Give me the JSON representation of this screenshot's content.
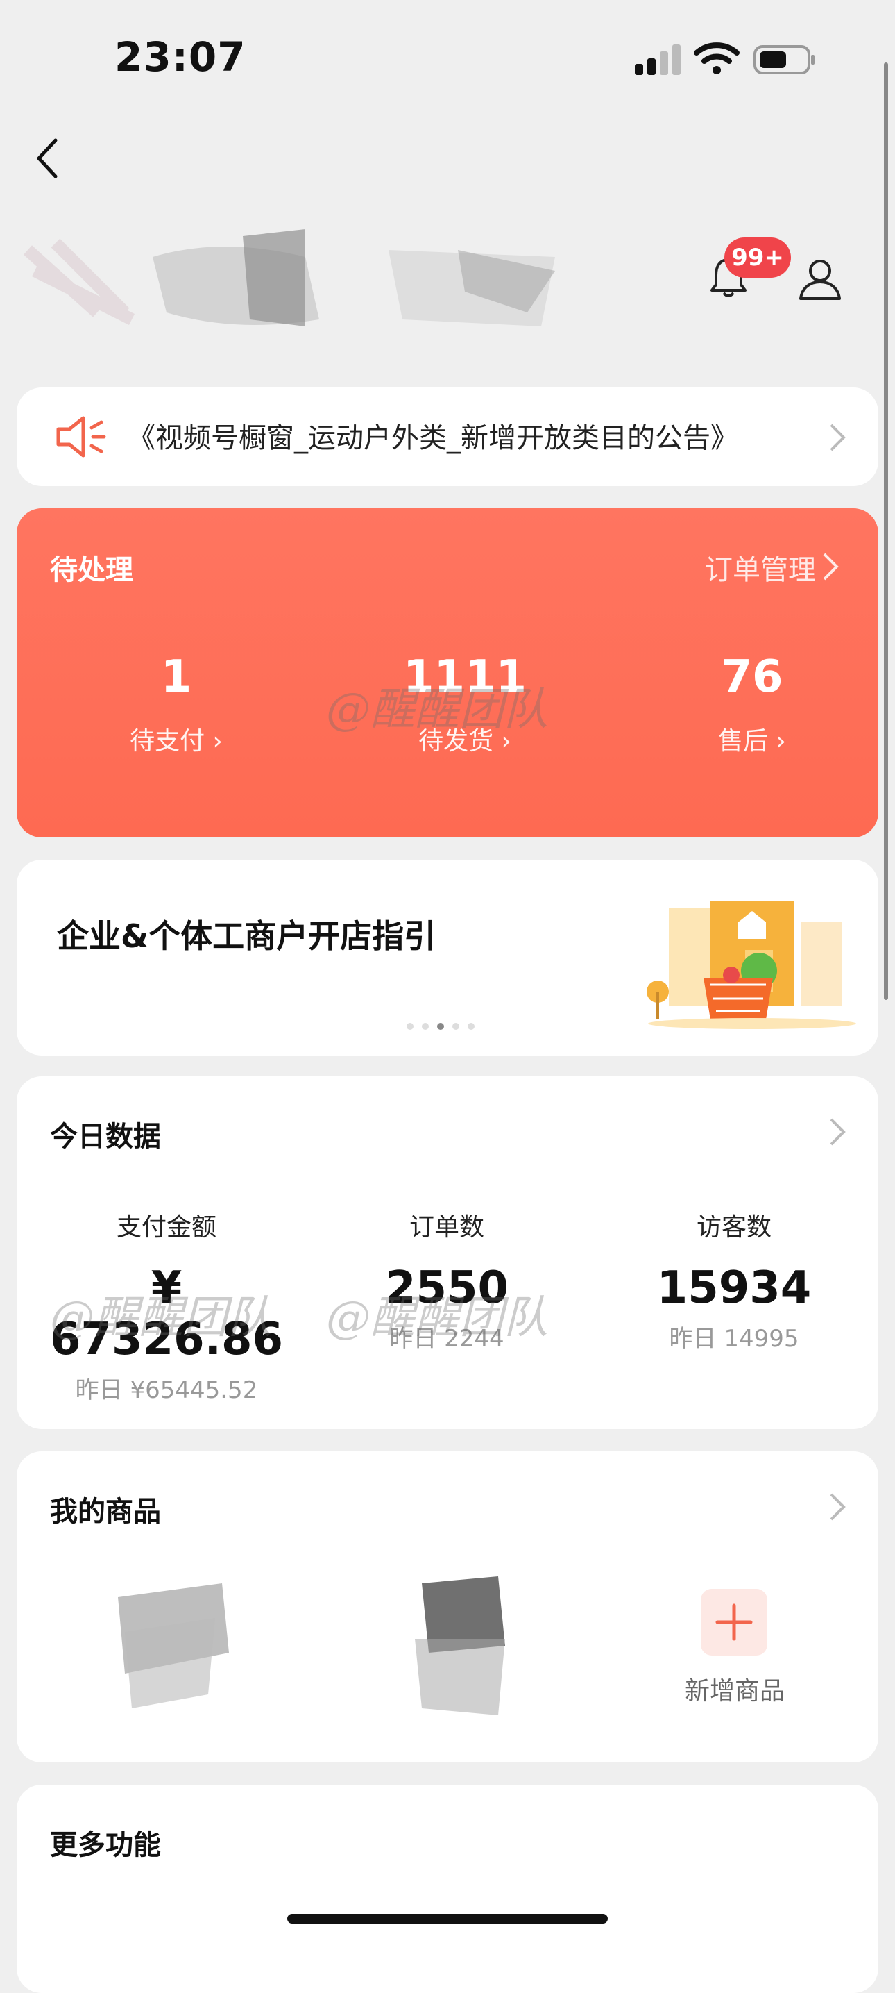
{
  "status_bar": {
    "time": "23:07"
  },
  "header": {
    "notification_badge": "99+"
  },
  "notice": {
    "text": "《视频号橱窗_运动户外类_新增开放类目的公告》"
  },
  "pending": {
    "title": "待处理",
    "link_label": "订单管理",
    "items": [
      {
        "value": "1",
        "label": "待支付"
      },
      {
        "value": "1111",
        "label": "待发货"
      },
      {
        "value": "76",
        "label": "售后"
      }
    ]
  },
  "banner": {
    "title": "企业&个体工商户开店指引",
    "dots_total": 5,
    "dots_active": 3
  },
  "today_data": {
    "title": "今日数据",
    "stats": [
      {
        "label": "支付金额",
        "value": "¥ 67326.86",
        "yesterday": "昨日 ¥65445.52"
      },
      {
        "label": "订单数",
        "value": "2550",
        "yesterday": "昨日 2244"
      },
      {
        "label": "访客数",
        "value": "15934",
        "yesterday": "昨日 14995"
      }
    ]
  },
  "my_products": {
    "title": "我的商品",
    "add_label": "新增商品"
  },
  "more": {
    "title": "更多功能"
  },
  "watermark": "@醒醒团队",
  "colors": {
    "accent": "#fe6a52",
    "badge": "#f0444a",
    "background": "#efefef"
  }
}
